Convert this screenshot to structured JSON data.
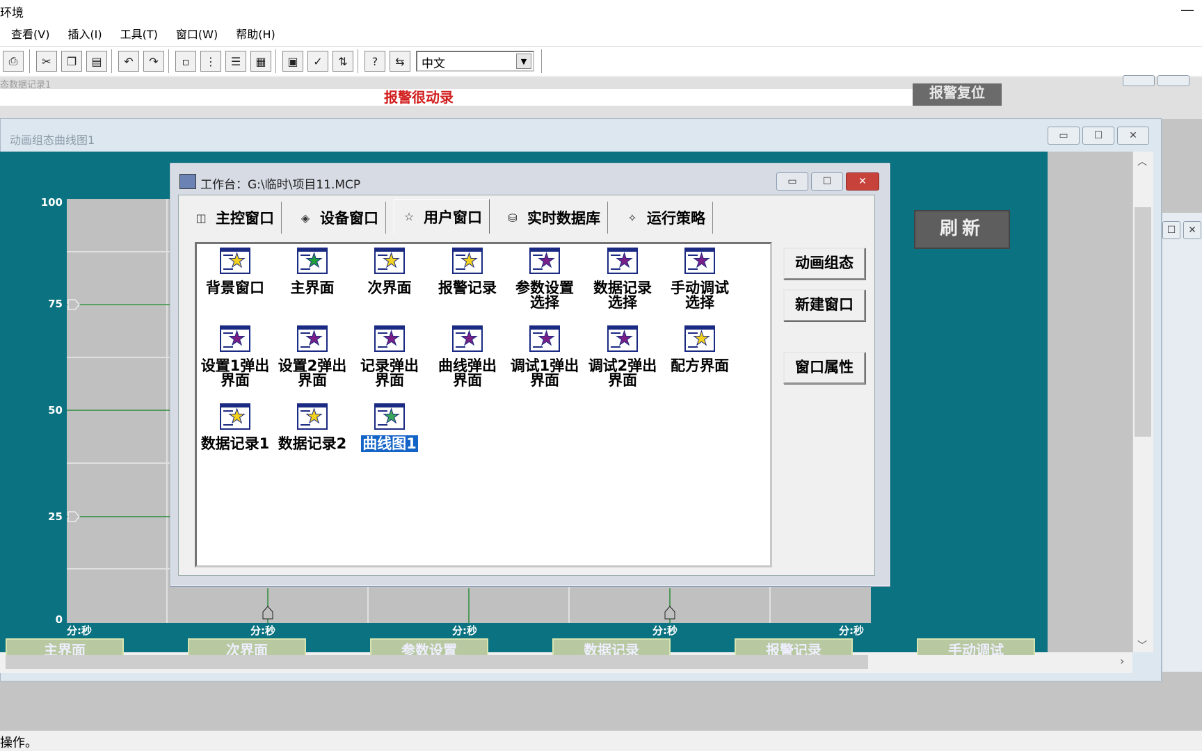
{
  "app": {
    "title": "环境",
    "minimize": "—"
  },
  "menu": [
    "查看(V)",
    "插入(I)",
    "工具(T)",
    "窗口(W)",
    "帮助(H)"
  ],
  "toolbar": {
    "language": "中文",
    "icons": [
      "preview-icon",
      "cut-icon",
      "copy-icon",
      "paste-icon",
      "undo-icon",
      "redo-icon",
      "align-left-icon",
      "tree-icon",
      "list-icon",
      "grid-icon",
      "properties-icon",
      "check-icon",
      "sort-icon",
      "help-icon",
      "translate-icon"
    ]
  },
  "background_window": {
    "title": "态数据记录1",
    "banner": "报警很动录",
    "reset_button": "报警复位"
  },
  "curve_window": {
    "title": "动画组态曲线图1",
    "refresh_button": "刷新",
    "y_ticks": [
      "100",
      "75",
      "50",
      "25",
      "0"
    ],
    "x_tick_label": "分:秒",
    "bottom_tabs": [
      "主界面",
      "次界面",
      "参数设置",
      "数据记录",
      "报警记录",
      "手动调试"
    ]
  },
  "workbench": {
    "title": "工作台：G:\\临时\\项目11.MCP",
    "tabs": [
      {
        "label": "主控窗口",
        "icon": "main-window-icon",
        "active": false
      },
      {
        "label": "设备窗口",
        "icon": "device-icon",
        "active": false
      },
      {
        "label": "用户窗口",
        "icon": "user-window-icon",
        "active": true
      },
      {
        "label": "实时数据库",
        "icon": "database-icon",
        "active": false
      },
      {
        "label": "运行策略",
        "icon": "strategy-icon",
        "active": false
      }
    ],
    "items": [
      {
        "label": "背景窗口",
        "star": "#f2d21c"
      },
      {
        "label": "主界面",
        "star": "#1fa03c"
      },
      {
        "label": "次界面",
        "star": "#f2d21c"
      },
      {
        "label": "报警记录",
        "star": "#f2d21c"
      },
      {
        "label": "参数设置选择",
        "star": "#7a1f86"
      },
      {
        "label": "数据记录选择",
        "star": "#7a1f86"
      },
      {
        "label": "手动调试选择",
        "star": "#7a1f86"
      },
      {
        "label": "设置1弹出界面",
        "star": "#7a1f86"
      },
      {
        "label": "设置2弹出界面",
        "star": "#7a1f86"
      },
      {
        "label": "记录弹出界面",
        "star": "#7a1f86"
      },
      {
        "label": "曲线弹出界面",
        "star": "#7a1f86"
      },
      {
        "label": "调试1弹出界面",
        "star": "#7a1f86"
      },
      {
        "label": "调试2弹出界面",
        "star": "#7a1f86"
      },
      {
        "label": "配方界面",
        "star": "#f2d21c"
      },
      {
        "label": "数据记录1",
        "star": "#f2d21c"
      },
      {
        "label": "数据记录2",
        "star": "#f2d21c"
      },
      {
        "label": "曲线图1",
        "star": "#3aa65a",
        "selected": true
      }
    ],
    "side_buttons": [
      "动画组态",
      "新建窗口",
      "窗口属性"
    ]
  },
  "status": {
    "text": "操作。"
  },
  "colors": {
    "teal": "#0a7280",
    "selection": "#1464c8",
    "close_red": "#c7423a"
  }
}
